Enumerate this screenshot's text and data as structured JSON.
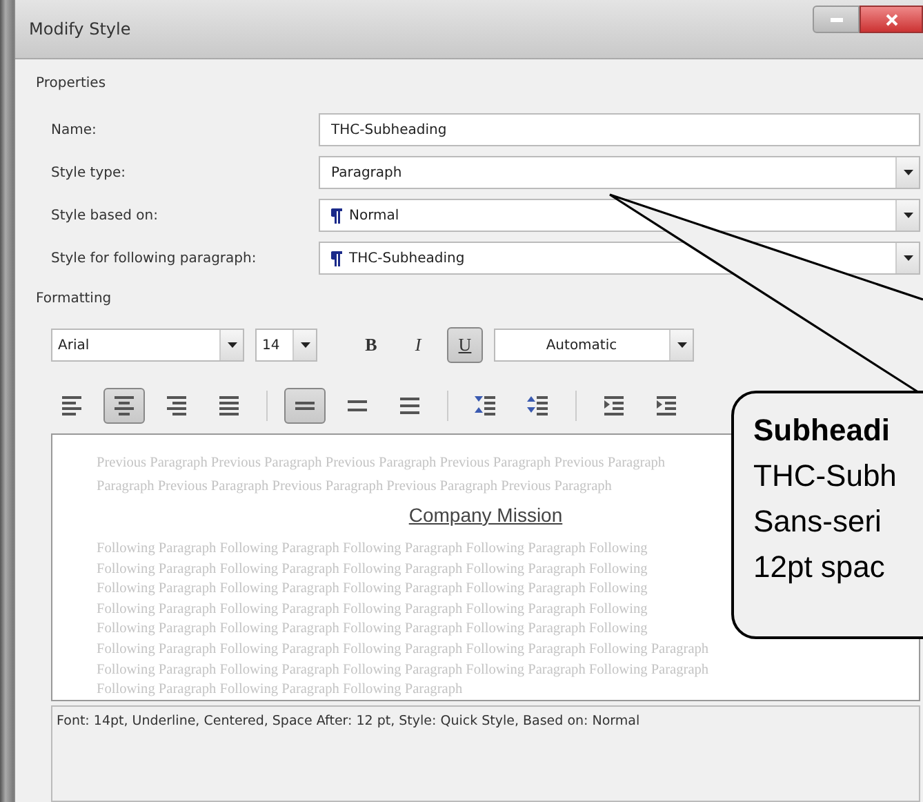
{
  "window": {
    "title": "Modify Style"
  },
  "properties": {
    "heading": "Properties",
    "fields": [
      {
        "label": "Name:",
        "value": "THC-Subheading",
        "kind": "text"
      },
      {
        "label": "Style type:",
        "value": "Paragraph",
        "kind": "dropdown"
      },
      {
        "label": "Style based on:",
        "value": "Normal",
        "kind": "style-dropdown"
      },
      {
        "label": "Style for following paragraph:",
        "value": "THC-Subheading",
        "kind": "style-dropdown"
      }
    ]
  },
  "formatting": {
    "heading": "Formatting",
    "font": "Arial",
    "size": "14",
    "font_color_label": "Automatic",
    "text_buttons": [
      {
        "label": "B",
        "kind": "bold",
        "selected": false
      },
      {
        "label": "I",
        "kind": "italic",
        "selected": false
      },
      {
        "label": "U",
        "kind": "underline",
        "selected": true
      }
    ],
    "paragraph_buttons": [
      [
        {
          "kind": "align-left",
          "selected": false
        },
        {
          "kind": "align-center",
          "selected": true
        },
        {
          "kind": "align-right",
          "selected": false
        },
        {
          "kind": "justify",
          "selected": false
        }
      ],
      [
        {
          "kind": "single-spacing",
          "selected": true
        },
        {
          "kind": "one-half-spacing",
          "selected": false
        },
        {
          "kind": "double-spacing",
          "selected": false
        }
      ],
      [
        {
          "kind": "space-before",
          "selected": false
        },
        {
          "kind": "space-after",
          "selected": false
        }
      ],
      [
        {
          "kind": "decrease-indent",
          "selected": false
        },
        {
          "kind": "increase-indent",
          "selected": false
        }
      ]
    ]
  },
  "preview": {
    "previous": [
      "Previous Paragraph Previous Paragraph Previous Paragraph Previous Paragraph Previous Paragraph",
      "Paragraph Previous Paragraph Previous Paragraph Previous Paragraph Previous Paragraph"
    ],
    "heading": "Company Mission",
    "following": [
      "Following Paragraph Following Paragraph Following Paragraph Following Paragraph Following",
      "Following Paragraph Following Paragraph Following Paragraph Following Paragraph Following",
      "Following Paragraph Following Paragraph Following Paragraph Following Paragraph Following",
      "Following Paragraph Following Paragraph Following Paragraph Following Paragraph Following",
      "Following Paragraph Following Paragraph Following Paragraph Following Paragraph Following",
      "Following Paragraph Following Paragraph Following Paragraph Following Paragraph Following Paragraph",
      "Following Paragraph Following Paragraph Following Paragraph Following Paragraph Following Paragraph",
      "Following Paragraph Following Paragraph Following Paragraph"
    ]
  },
  "description": "Font: 14pt, Underline, Centered, Space After:  12 pt, Style: Quick Style, Based on: Normal",
  "callout": {
    "title": "Subheadi",
    "lines": [
      "THC-Subh",
      "Sans-seri",
      "12pt spac"
    ]
  }
}
